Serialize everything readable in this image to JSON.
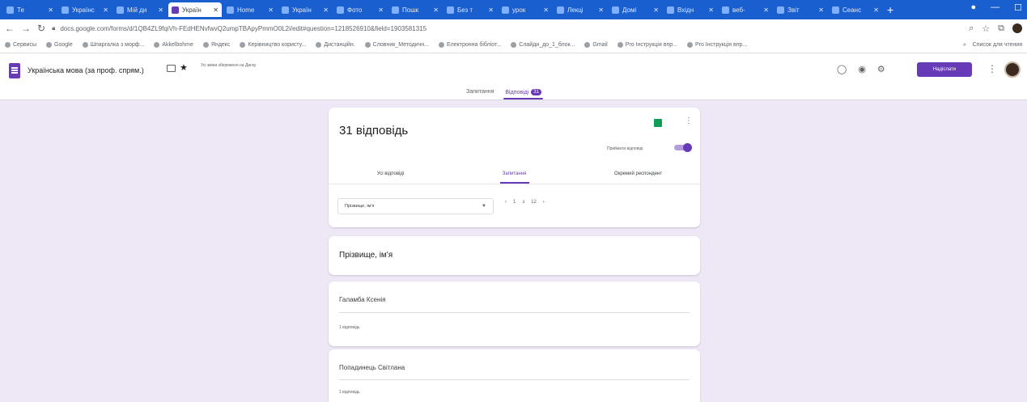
{
  "browser": {
    "tabs": [
      {
        "title": "Те"
      },
      {
        "title": "Українс"
      },
      {
        "title": "Мій ди"
      },
      {
        "title": "Україн",
        "active": true
      },
      {
        "title": "Home"
      },
      {
        "title": "Україн"
      },
      {
        "title": "Фото"
      },
      {
        "title": "Пошк"
      },
      {
        "title": "Без т"
      },
      {
        "title": "урок"
      },
      {
        "title": "Лекці"
      },
      {
        "title": "Домi"
      },
      {
        "title": "Вхідн"
      },
      {
        "title": "веб-"
      },
      {
        "title": "Звіт"
      },
      {
        "title": "Сеанс"
      }
    ],
    "new_tab": "+",
    "url": "docs.google.com/forms/d/1QB4ZL9fqiVh-FEdHENvfwvQ2umpTBApyPmmO0L2i/edit#question=1218526910&field=1903581315",
    "bookmarks": [
      "Сервисы",
      "Google",
      "Шпаргалка з морф...",
      "Akkelbohme",
      "Яндекс",
      "Керівництво користу...",
      "Дистанційн.",
      "Словник_Методичн...",
      "Електронна бібліот...",
      "Слайди_до_1_блок...",
      "Gmail",
      "Pro Інструкція впр...",
      "Pro Інструкція впр..."
    ],
    "bookmarks_right": "Список для чтения"
  },
  "form": {
    "title": "Українська мова (за проф. спрям.)",
    "save_status": "Усі зміни збережено на Диску",
    "send_label": "Надіслати",
    "tabs": {
      "questions": "Запитання",
      "responses": "Відповіді",
      "responses_badge": "31"
    }
  },
  "summary": {
    "count_title": "31 відповідь",
    "accepting_label": "Приймати відповіді",
    "view_tabs": [
      "Усі відповіді",
      "Запитання",
      "Окремий респондент"
    ],
    "question_select": "Прізвище, ім'я",
    "pager": {
      "prev": "‹",
      "current": "1",
      "of": "з",
      "total": "12",
      "next": "›"
    }
  },
  "question": {
    "title": "Прізвище, ім'я"
  },
  "answers": [
    {
      "name": "Галамба Ксенія",
      "count": "1 відповідь"
    },
    {
      "name": "Попадинець Світлана",
      "count": "1 відповідь"
    }
  ]
}
